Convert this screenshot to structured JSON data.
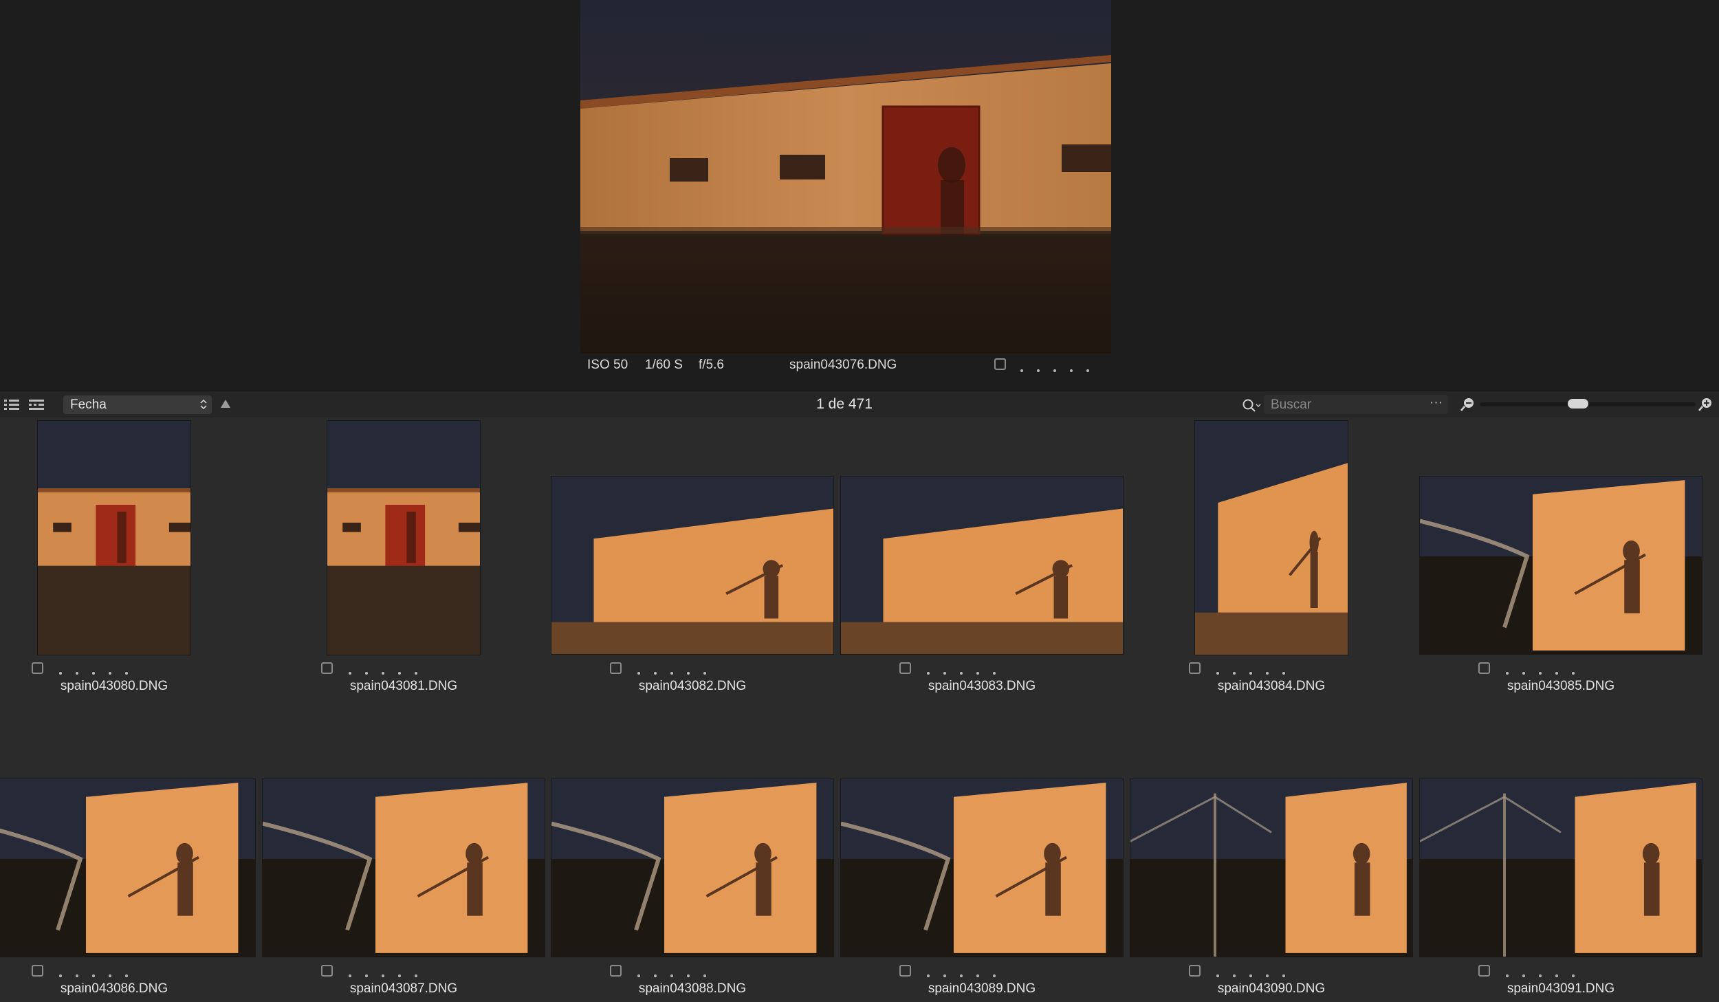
{
  "viewer": {
    "iso": "ISO 50",
    "shutter": "1/60 S",
    "aperture": "f/5.6",
    "filename": "spain043076.DNG",
    "rating_dots": 5
  },
  "toolbar": {
    "sort_value": "Fecha",
    "counter": "1 de 471",
    "search_placeholder": "Buscar",
    "search_more": "···",
    "zoom_level": 0.45
  },
  "grid": {
    "row1": [
      {
        "name": "spain043080.DNG",
        "scene": "barn",
        "orient": "portrait"
      },
      {
        "name": "spain043081.DNG",
        "scene": "barn",
        "orient": "portrait"
      },
      {
        "name": "spain043082.DNG",
        "scene": "wall",
        "orient": "landscape"
      },
      {
        "name": "spain043083.DNG",
        "scene": "wall",
        "orient": "landscape"
      },
      {
        "name": "spain043084.DNG",
        "scene": "wall",
        "orient": "portrait"
      },
      {
        "name": "spain043085.DNG",
        "scene": "cloth",
        "orient": "landscape"
      }
    ],
    "row2": [
      {
        "name": "spain043086.DNG",
        "scene": "cloth",
        "orient": "landscape"
      },
      {
        "name": "spain043087.DNG",
        "scene": "cloth",
        "orient": "landscape"
      },
      {
        "name": "spain043088.DNG",
        "scene": "cloth",
        "orient": "landscape"
      },
      {
        "name": "spain043089.DNG",
        "scene": "cloth",
        "orient": "landscape"
      },
      {
        "name": "spain043090.DNG",
        "scene": "fence",
        "orient": "landscape"
      },
      {
        "name": "spain043091.DNG",
        "scene": "fence",
        "orient": "landscape"
      }
    ]
  },
  "colors": {
    "sky": "#2b2f3e",
    "wall": "#d38a4a",
    "ground": "#3a2a1c",
    "door": "#8a2416",
    "shadow": "#5a3a24"
  }
}
